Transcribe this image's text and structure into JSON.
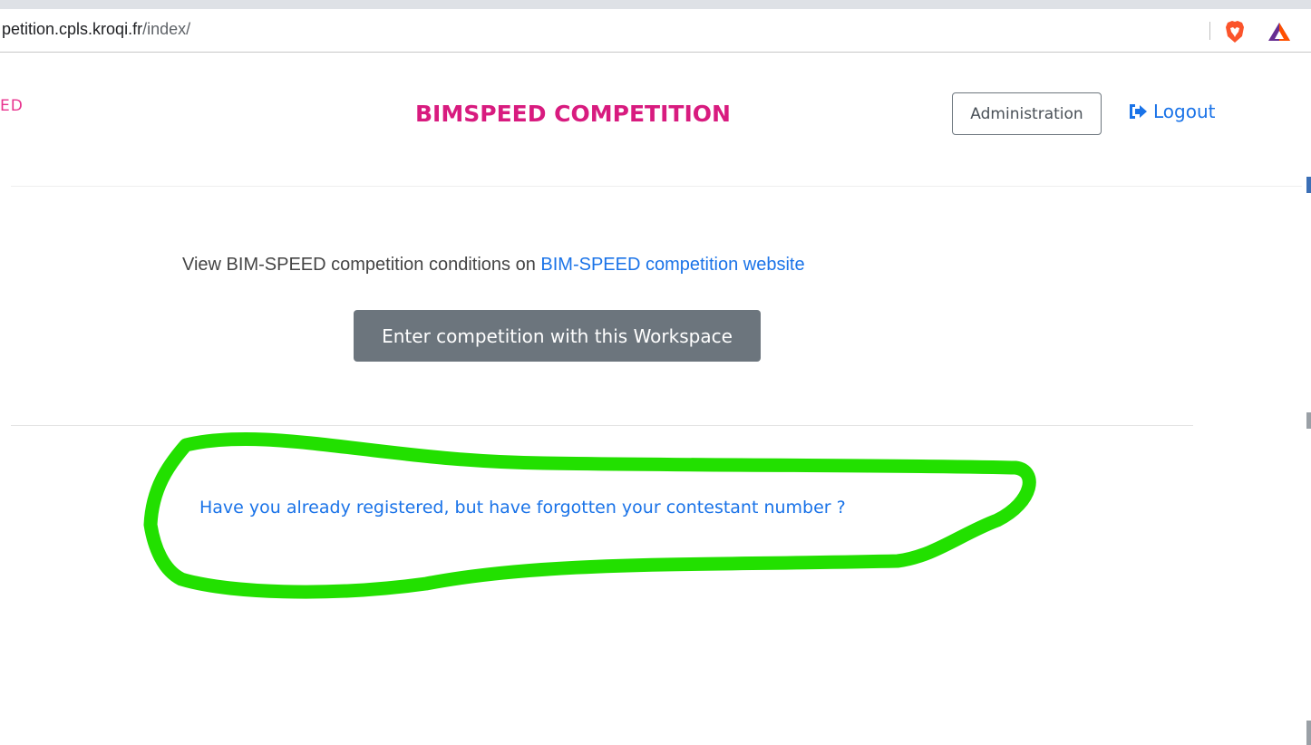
{
  "browser": {
    "url_host": "petition.cpls.kroqi.fr",
    "url_path": "/index/",
    "icons": [
      "brave-lion-icon",
      "bat-triangle-icon"
    ]
  },
  "header": {
    "logo_fragment": "ED",
    "title": "BIMSPEED COMPETITION",
    "admin_label": "Administration",
    "logout_label": "Logout",
    "logout_icon": "sign-out-icon"
  },
  "main": {
    "conditions_text": "View BIM-SPEED competition conditions on",
    "conditions_link": "BIM-SPEED competition website",
    "enter_button": "Enter competition with this Workspace",
    "forgot_link": "Have you already registered, but have forgotten your contestant number ?"
  },
  "colors": {
    "brand_pink": "#d81b7f",
    "link_blue": "#1a73e8",
    "button_gray": "#6c757d",
    "annotation_green": "#22e000"
  }
}
